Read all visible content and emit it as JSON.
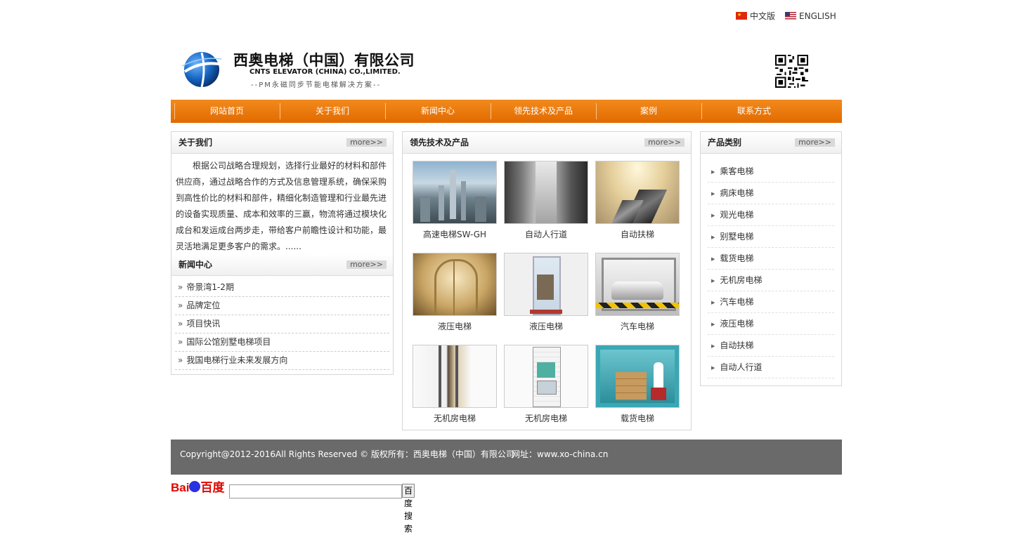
{
  "lang": {
    "cn": "中文版",
    "en": "ENGLISH"
  },
  "brand": {
    "cn": "西奥电梯（中国）有限公司",
    "en": "CNTS ELEVATOR (CHINA) CO.,LIMITED.",
    "slogan": "--PM永磁同步节能电梯解决方案--"
  },
  "nav": [
    "网站首页",
    "关于我们",
    "新闻中心",
    "领先技术及产品",
    "案例",
    "联系方式"
  ],
  "about": {
    "title": "关于我们",
    "more": "more>>",
    "text": "根据公司战略合理规划，选择行业最好的材料和部件供应商，通过战略合作的方式及信息管理系统，确保采购到高性价比的材料和部件，精细化制造管理和行业最先进的设备实现质量、成本和效率的三赢，物流将通过模块化成台和发运成台两步走，带给客户前瞻性设计和功能，最灵活地满足更多客户的需求。......"
  },
  "news": {
    "title": "新闻中心",
    "more": "more>>",
    "items": [
      "帝景湾1-2期",
      "品牌定位",
      "项目快讯",
      "国际公馆别墅电梯项目",
      "我国电梯行业未来发展方向"
    ]
  },
  "products": {
    "title": "领先技术及产品",
    "more": "more>>",
    "items": [
      "高速电梯SW-GH",
      "自动人行道",
      "自动扶梯",
      "液压电梯",
      "液压电梯",
      "汽车电梯",
      "无机房电梯",
      "无机房电梯",
      "载货电梯"
    ]
  },
  "categories": {
    "title": "产品类别",
    "more": "more>>",
    "items": [
      "乘客电梯",
      "病床电梯",
      "观光电梯",
      "别墅电梯",
      "载货电梯",
      "无机房电梯",
      "汽车电梯",
      "液压电梯",
      "自动扶梯",
      "自动人行道"
    ]
  },
  "footer": {
    "copyright": "Copyright@2012-2016All Rights Reserved © 版权所有：西奥电梯（中国）有限公司",
    "url": "网址：www.xo-china.cn"
  },
  "baidu": {
    "logo": "Bai百度",
    "button": "百度搜索",
    "input_value": ""
  }
}
